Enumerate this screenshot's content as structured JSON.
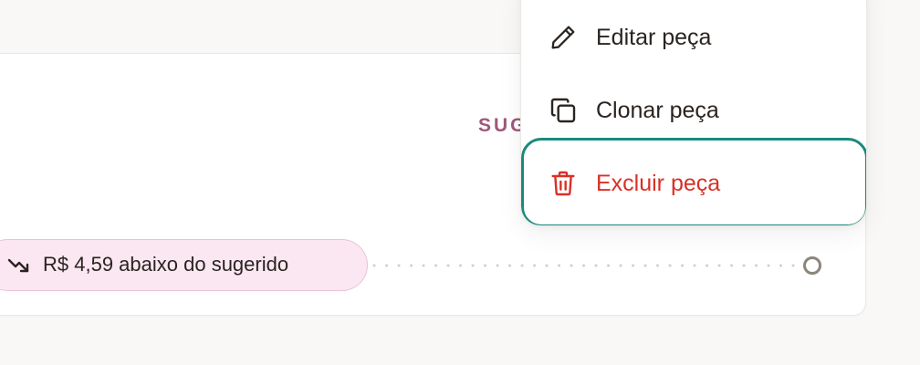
{
  "card": {
    "suggested_label": "SUG"
  },
  "price_indicator": {
    "text": "R$ 4,59 abaixo do sugerido",
    "icon": "trending-down-icon"
  },
  "context_menu": {
    "items": [
      {
        "label": "Editar peça",
        "icon": "pencil-icon"
      },
      {
        "label": "Clonar peça",
        "icon": "copy-icon"
      },
      {
        "label": "Excluir peça",
        "icon": "trash-icon",
        "color": "#d93025",
        "state": "focused"
      }
    ]
  },
  "colors": {
    "accent_teal": "#1a8a7e",
    "danger": "#d93025",
    "suggested_label": "#a0587a",
    "pill_background": "#fbe7f1"
  }
}
